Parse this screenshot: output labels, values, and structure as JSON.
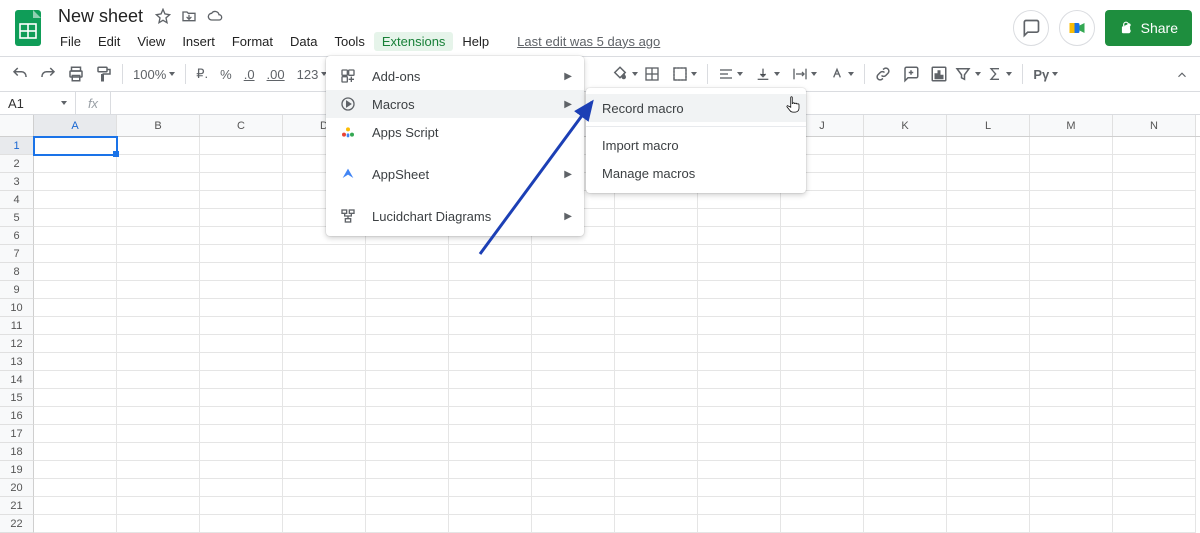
{
  "title": "New sheet",
  "menubar": [
    "File",
    "Edit",
    "View",
    "Insert",
    "Format",
    "Data",
    "Tools",
    "Extensions",
    "Help"
  ],
  "active_menu": "Extensions",
  "last_edit": "Last edit was 5 days ago",
  "share_label": "Share",
  "toolbar": {
    "zoom": "100%",
    "currency_btn": "₽.",
    "percent_btn": "%",
    "dec_less": ".0",
    "dec_more": ".00",
    "num_fmt": "123"
  },
  "formula": {
    "name_box": "A1",
    "fx_label": "fx"
  },
  "columns": [
    "A",
    "B",
    "C",
    "D",
    "E",
    "F",
    "G",
    "H",
    "I",
    "J",
    "K",
    "L",
    "M",
    "N"
  ],
  "row_count": 22,
  "selected_cell": {
    "row": 1,
    "col": "A"
  },
  "extensions_menu": {
    "items": [
      {
        "icon": "addons",
        "label": "Add-ons",
        "submenu": true
      },
      {
        "icon": "macros",
        "label": "Macros",
        "submenu": true,
        "hover": true
      },
      {
        "icon": "appsscript",
        "label": "Apps Script",
        "submenu": false
      },
      {
        "gap": true
      },
      {
        "icon": "appsheet",
        "label": "AppSheet",
        "submenu": true
      },
      {
        "gap": true
      },
      {
        "icon": "lucid",
        "label": "Lucidchart Diagrams",
        "submenu": true
      }
    ]
  },
  "macros_submenu": {
    "items": [
      {
        "label": "Record macro",
        "hover": true
      },
      {
        "div": true
      },
      {
        "label": "Import macro"
      },
      {
        "label": "Manage macros"
      }
    ]
  }
}
